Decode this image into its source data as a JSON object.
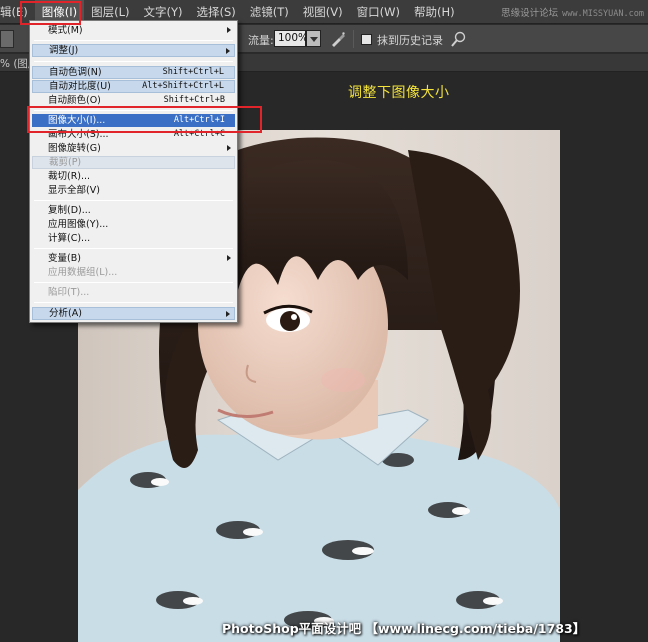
{
  "menubar": {
    "items": [
      {
        "label": "辑(E)"
      },
      {
        "label": "图像(I)",
        "active": true
      },
      {
        "label": "图层(L)"
      },
      {
        "label": "文字(Y)"
      },
      {
        "label": "选择(S)"
      },
      {
        "label": "滤镜(T)"
      },
      {
        "label": "视图(V)"
      },
      {
        "label": "窗口(W)"
      },
      {
        "label": "帮助(H)"
      }
    ],
    "watermark": "思缘设计论坛",
    "watermark_site": "www.MISSYUAN.com"
  },
  "options": {
    "flow_label": "流量:",
    "flow_value": "100%",
    "erase_history_label": "抹到历史记录",
    "erase_history_checked": false
  },
  "doc_tab": {
    "title": "% (图层"
  },
  "image_menu": {
    "items": [
      {
        "label": "模式(M)",
        "shortcut": "",
        "submenu": true,
        "style": "normal"
      },
      {
        "label": "调整(J)",
        "shortcut": "",
        "submenu": true,
        "style": "hl"
      },
      {
        "label": "自动色调(N)",
        "shortcut": "Shift+Ctrl+L",
        "submenu": false,
        "style": "hl"
      },
      {
        "label": "自动对比度(U)",
        "shortcut": "Alt+Shift+Ctrl+L",
        "submenu": false,
        "style": "hl"
      },
      {
        "label": "自动颜色(O)",
        "shortcut": "Shift+Ctrl+B",
        "submenu": false,
        "style": "normal"
      },
      {
        "label": "图像大小(I)...",
        "shortcut": "Alt+Ctrl+I",
        "submenu": false,
        "style": "sel"
      },
      {
        "label": "画布大小(S)...",
        "shortcut": "Alt+Ctrl+C",
        "submenu": false,
        "style": "normal"
      },
      {
        "label": "图像旋转(G)",
        "shortcut": "",
        "submenu": true,
        "style": "normal"
      },
      {
        "label": "裁剪(P)",
        "shortcut": "",
        "submenu": false,
        "style": "dis-hl"
      },
      {
        "label": "裁切(R)...",
        "shortcut": "",
        "submenu": false,
        "style": "normal"
      },
      {
        "label": "显示全部(V)",
        "shortcut": "",
        "submenu": false,
        "style": "normal"
      },
      {
        "label": "复制(D)...",
        "shortcut": "",
        "submenu": false,
        "style": "normal"
      },
      {
        "label": "应用图像(Y)...",
        "shortcut": "",
        "submenu": false,
        "style": "normal"
      },
      {
        "label": "计算(C)...",
        "shortcut": "",
        "submenu": false,
        "style": "normal"
      },
      {
        "label": "变量(B)",
        "shortcut": "",
        "submenu": true,
        "style": "normal"
      },
      {
        "label": "应用数据组(L)...",
        "shortcut": "",
        "submenu": false,
        "style": "dis"
      },
      {
        "label": "陷印(T)...",
        "shortcut": "",
        "submenu": false,
        "style": "dis"
      },
      {
        "label": "分析(A)",
        "shortcut": "",
        "submenu": true,
        "style": "hl"
      }
    ]
  },
  "caption": "调整下图像大小",
  "footer": "PhotoShop平面设计吧 【www.linecg.com/tieba/1783】",
  "colors": {
    "annotation_red": "#e0242a",
    "caption_yellow": "#f3e33a",
    "menu_selected": "#3a6fc5"
  }
}
